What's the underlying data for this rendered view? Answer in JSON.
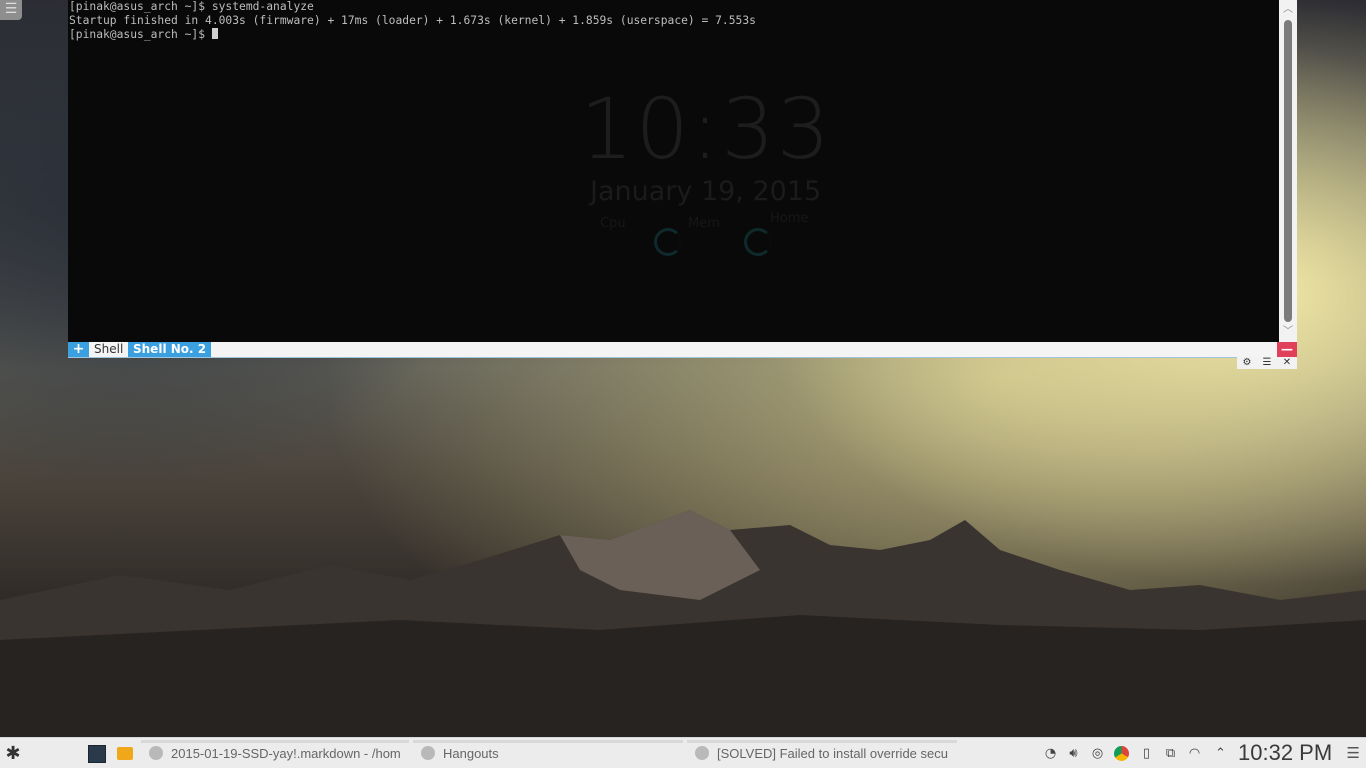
{
  "terminal": {
    "lines": [
      "[pinak@asus_arch ~]$ systemd-analyze",
      "Startup finished in 4.003s (firmware) + 17ms (loader) + 1.673s (kernel) + 1.859s (userspace) = 7.553s",
      "[pinak@asus_arch ~]$ "
    ],
    "background_widget": {
      "time": "10:33",
      "date": "January 19, 2015",
      "labels": [
        "Cpu",
        "Mem",
        "Home"
      ]
    }
  },
  "tabs": {
    "add_label": "+",
    "items": [
      {
        "label": "Shell",
        "active": false
      },
      {
        "label": "Shell No. 2",
        "active": true
      }
    ],
    "close_label": "—"
  },
  "term_controls": {
    "settings_icon": "gear-icon",
    "menu_icon": "menu-icon",
    "close_label": "✕"
  },
  "taskbar": {
    "tasks": [
      {
        "label": "2015-01-19-SSD-yay!.markdown - /hom",
        "icon": "document-icon"
      },
      {
        "label": "Hangouts",
        "icon": "chat-icon"
      },
      {
        "label": "[SOLVED] Failed to install override secu",
        "icon": "chrome-icon"
      }
    ],
    "clock": "10:32 PM"
  },
  "colors": {
    "accent": "#3aa0df",
    "close_red": "#e0405a",
    "terminal_bg": "#090909"
  }
}
